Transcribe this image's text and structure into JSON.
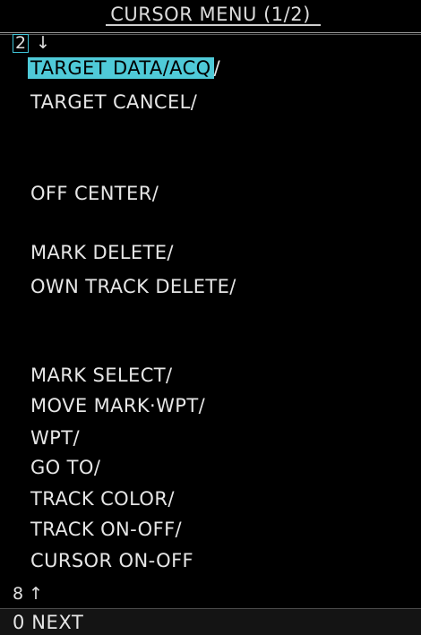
{
  "header": {
    "title": "CURSOR MENU (1/2)"
  },
  "scroll_up": {
    "key": "2",
    "arrow": "↓"
  },
  "menu": {
    "items": [
      {
        "label": "TARGET DATA/ACQ",
        "suffix": "/",
        "selected": true
      },
      {
        "label": "TARGET CANCEL/"
      },
      {
        "label": "OFF CENTER/"
      },
      {
        "label": "MARK DELETE/"
      },
      {
        "label": "OWN TRACK DELETE/"
      },
      {
        "label": "MARK SELECT/"
      },
      {
        "label": "MOVE MARK·WPT/"
      },
      {
        "label": "WPT/"
      },
      {
        "label": "GO TO/"
      },
      {
        "label": "TRACK COLOR/"
      },
      {
        "label": "TRACK ON-OFF/"
      },
      {
        "label": "CURSOR ON-OFF"
      }
    ]
  },
  "scroll_down": {
    "label": "8 ↑"
  },
  "footer": {
    "next_label": "0 NEXT"
  },
  "colors": {
    "background": "#000000",
    "text": "#e6e6e6",
    "highlight": "#4fcad8"
  }
}
